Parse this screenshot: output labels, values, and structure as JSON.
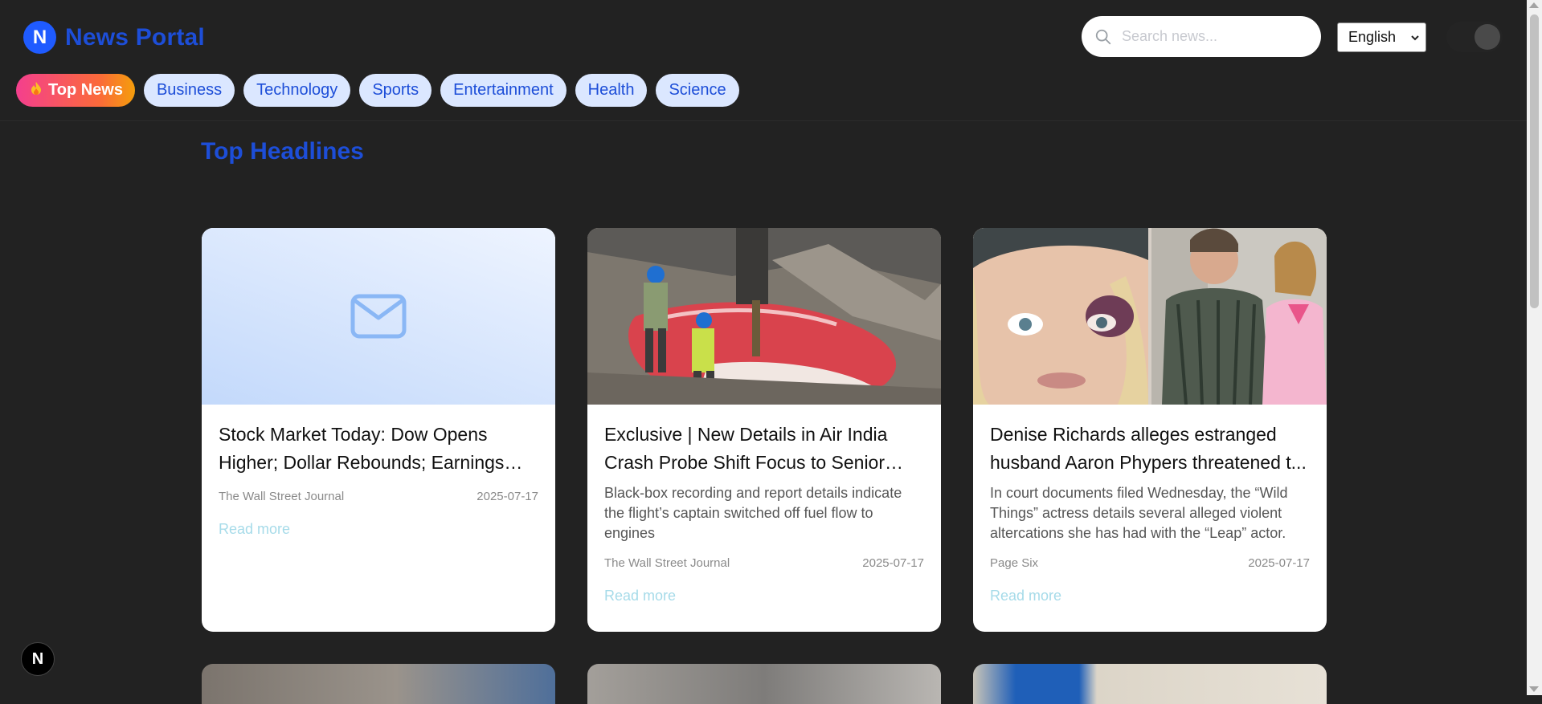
{
  "header": {
    "logo_letter": "N",
    "title": "News Portal",
    "search_placeholder": "Search news...",
    "language": "English"
  },
  "tabs": [
    {
      "label": "Top News",
      "active": true,
      "icon": "fire-icon"
    },
    {
      "label": "Business"
    },
    {
      "label": "Technology"
    },
    {
      "label": "Sports"
    },
    {
      "label": "Entertainment"
    },
    {
      "label": "Health"
    },
    {
      "label": "Science"
    }
  ],
  "section": {
    "title": "Top Headlines"
  },
  "articles": [
    {
      "title": "Stock Market Today: Dow Opens Higher; Dollar Rebounds; Earnings in...",
      "description": "",
      "source": "The Wall Street Journal",
      "date": "2025-07-17",
      "link": "Read more",
      "image": "placeholder-mail-icon"
    },
    {
      "title": "Exclusive | New Details in Air India Crash Probe Shift Focus to Senior Pil...",
      "description": "Black-box recording and report details indicate the flight’s captain switched off fuel flow to engines",
      "source": "The Wall Street Journal",
      "date": "2025-07-17",
      "link": "Read more",
      "image": "plane-wreckage-photo"
    },
    {
      "title": "Denise Richards alleges estranged husband Aaron Phypers threatened t...",
      "description": "In court documents filed Wednesday, the “Wild Things” actress details several alleged violent altercations she has had with the “Leap” actor.",
      "source": "Page Six",
      "date": "2025-07-17",
      "link": "Read more",
      "image": "people-photo"
    }
  ],
  "dev_badge": "N",
  "colors": {
    "brand": "#1d4ed8",
    "background": "#222222",
    "tab_bg": "#dbe7ff",
    "read_more": "#a6dbe9"
  }
}
